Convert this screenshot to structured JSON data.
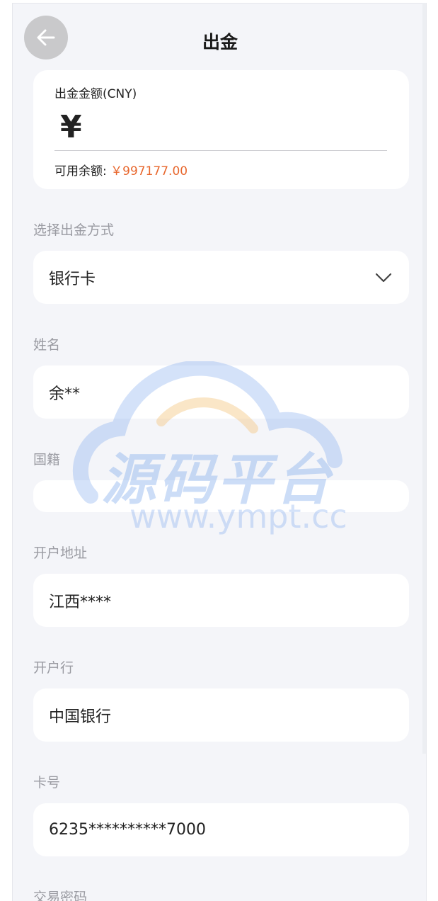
{
  "header": {
    "title": "出金"
  },
  "amount_card": {
    "label": "出金金额(CNY)",
    "currency_symbol": "¥",
    "balance_label": "可用余额:",
    "balance_value": "￥997177.00"
  },
  "method": {
    "label": "选择出金方式",
    "value": "银行卡"
  },
  "name": {
    "label": "姓名",
    "value": "余**"
  },
  "nationality": {
    "label": "国籍",
    "value": ""
  },
  "address": {
    "label": "开户地址",
    "value": "江西****"
  },
  "bank": {
    "label": "开户行",
    "value": "中国银行"
  },
  "card_no": {
    "label": "卡号",
    "value": "6235**********7000"
  },
  "password": {
    "label": "交易密码"
  },
  "watermark": {
    "text": "源码平台",
    "url": "www.ympt.cc"
  },
  "colors": {
    "accent": "#e8672d",
    "background": "#f4f5f9",
    "label": "#9a9ba2"
  }
}
